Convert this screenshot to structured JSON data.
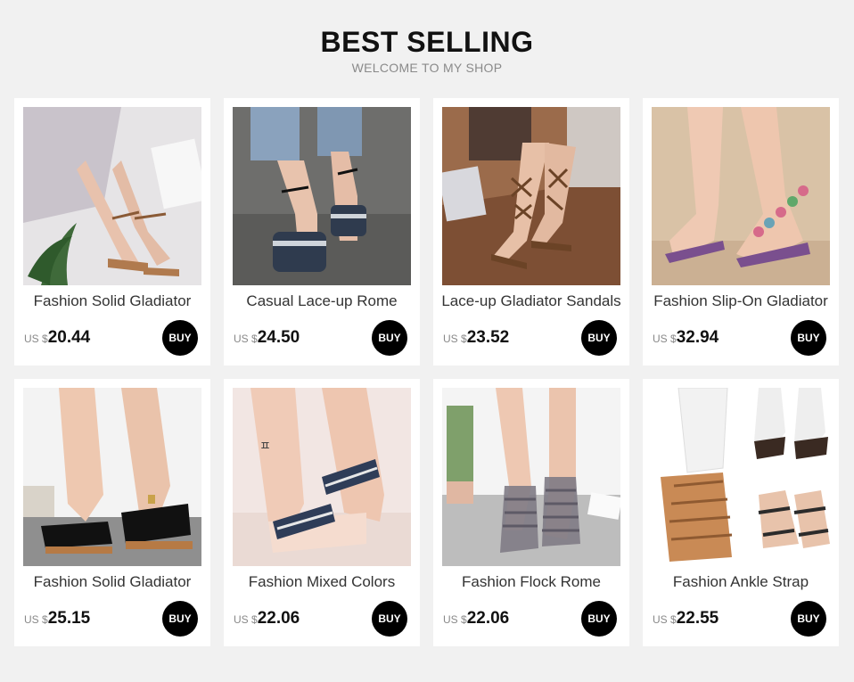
{
  "header": {
    "title": "BEST SELLING",
    "subtitle": "WELCOME TO MY SHOP"
  },
  "products": [
    {
      "name": "Fashion Solid Gladiator",
      "currency": "US $",
      "price": "20.44",
      "buy_label": "BUY"
    },
    {
      "name": "Casual Lace-up Rome",
      "currency": "US $",
      "price": "24.50",
      "buy_label": "BUY"
    },
    {
      "name": "Lace-up Gladiator Sandals",
      "currency": "US $",
      "price": "23.52",
      "buy_label": "BUY"
    },
    {
      "name": "Fashion Slip-On Gladiator",
      "currency": "US $",
      "price": "32.94",
      "buy_label": "BUY"
    },
    {
      "name": "Fashion Solid Gladiator",
      "currency": "US $",
      "price": "25.15",
      "buy_label": "BUY"
    },
    {
      "name": "Fashion Mixed Colors",
      "currency": "US $",
      "price": "22.06",
      "buy_label": "BUY"
    },
    {
      "name": "Fashion Flock Rome",
      "currency": "US $",
      "price": "22.06",
      "buy_label": "BUY"
    },
    {
      "name": "Fashion Ankle Strap",
      "currency": "US $",
      "price": "22.55",
      "buy_label": "BUY"
    }
  ]
}
